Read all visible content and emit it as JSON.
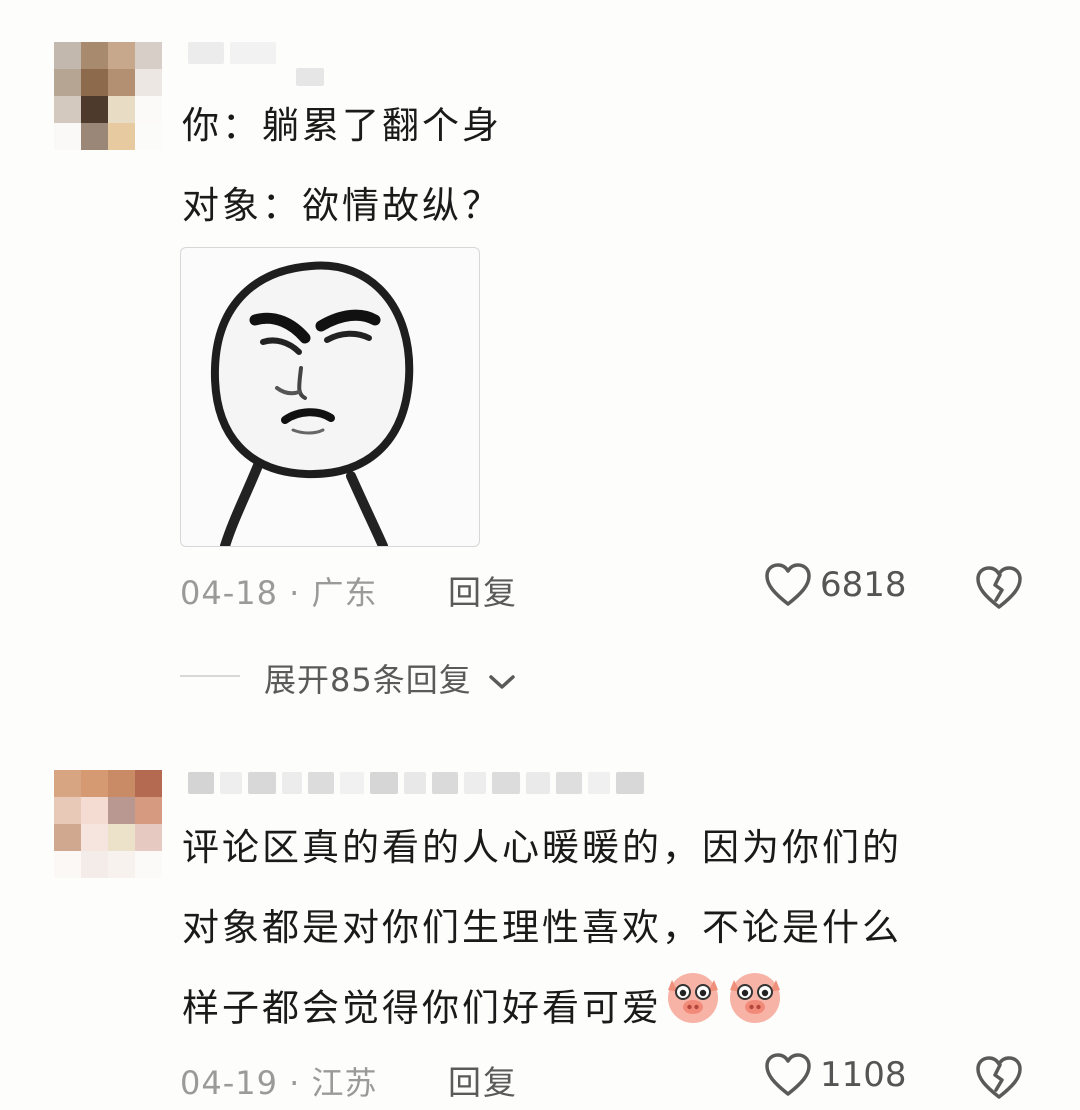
{
  "comments": [
    {
      "lines": [
        "你：躺累了翻个身",
        "对象：欲情故纵？"
      ],
      "date": "04-18",
      "location": "广东",
      "reply_label": "回复",
      "like_count": "6818",
      "expand_label": "展开85条回复"
    },
    {
      "lines": [
        "评论区真的看的人心暖暖的，因为你们的",
        "对象都是对你们生理性喜欢，不论是什么",
        "样子都会觉得你们好看可爱"
      ],
      "date": "04-19",
      "location": "江苏",
      "reply_label": "回复",
      "like_count": "1108"
    }
  ],
  "separator_dot": "·",
  "icons": {
    "like": "heart-outline-icon",
    "dislike": "broken-heart-icon",
    "expand": "chevron-down-icon",
    "emoji": "pig-face-emoji"
  },
  "colors": {
    "text": "#1a1a1a",
    "meta": "#9a9a9a",
    "secondary": "#5a5a5a",
    "background": "#fdfdfb"
  }
}
